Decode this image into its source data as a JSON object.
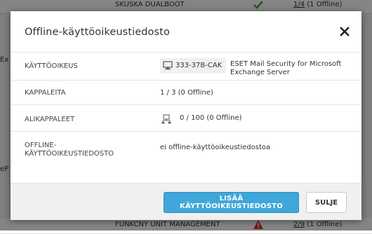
{
  "background": {
    "rows": [
      {
        "name": "SKUSKA DUALBOOT",
        "status": "ok",
        "count_link": "1/4",
        "count_rest": " (1 Offline)"
      },
      {
        "name": "FUNKCNY UNIT MANAGEMENT",
        "status": "warning",
        "count_link": "2/9",
        "count_rest": " (1 Offline)"
      }
    ],
    "fragments": [
      "Ex",
      "eP"
    ],
    "colors": {
      "ok": "#4caa3c",
      "warning": "#d9312b"
    }
  },
  "modal": {
    "title": "Offline-käyttöoikeustiedosto",
    "close_icon": "close-icon",
    "rows": {
      "license": {
        "label": "KÄYTTÖOIKEUS",
        "license_id": "333-37B-CAK",
        "product": "ESET Mail Security for Microsoft Exchange Server"
      },
      "units": {
        "label": "KAPPALEITA",
        "value": "1 / 3 (0 Offline)"
      },
      "subunits": {
        "label": "ALIKAPPALEET",
        "value": "0 / 100 (0 Offline)"
      },
      "offline_file": {
        "label": "OFFLINE-KÄYTTÖOIKEUSTIEDOSTO",
        "value": "ei offline-käyttöoikeustiedostoa"
      }
    },
    "footer": {
      "add_button": "LISÄÄ KÄYTTÖOIKEUSTIEDOSTO",
      "close_button": "SULJE"
    },
    "accent_color": "#3fa7d9"
  }
}
